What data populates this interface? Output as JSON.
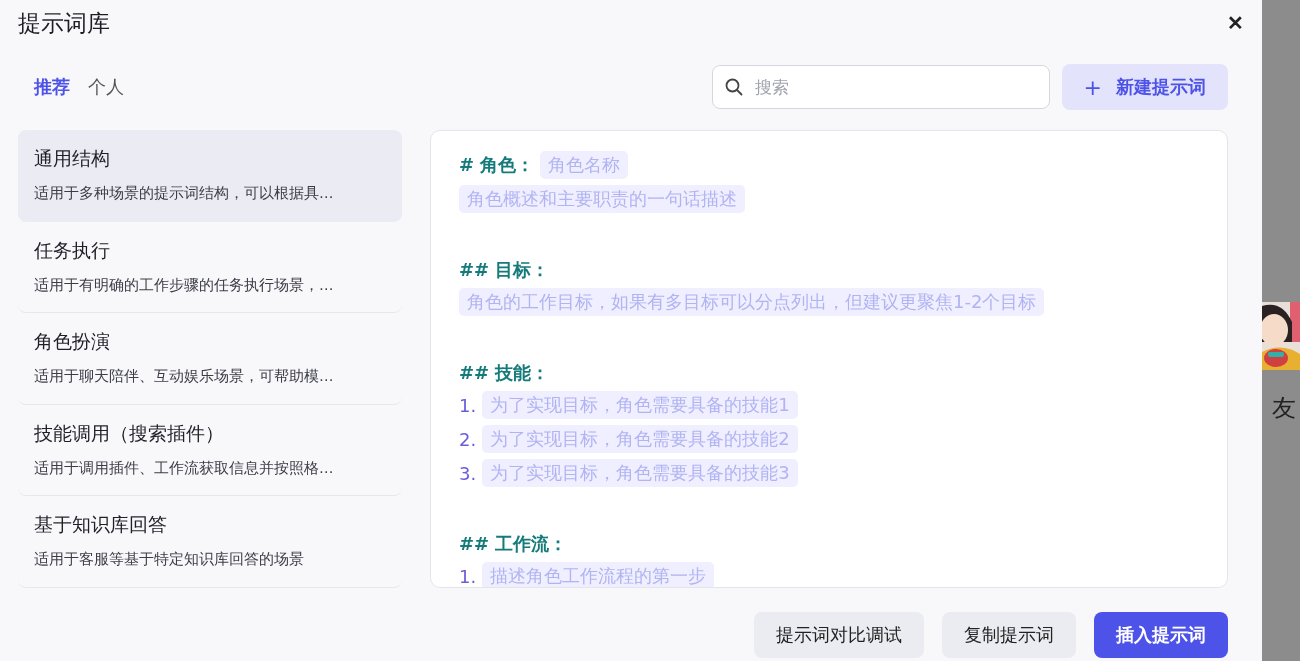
{
  "dialog": {
    "title": "提示词库",
    "close": "✕"
  },
  "tabs": [
    {
      "label": "推荐",
      "selected": true
    },
    {
      "label": "个人",
      "selected": false
    }
  ],
  "search": {
    "placeholder": "搜索"
  },
  "new_button": {
    "icon": "+",
    "label": "新建提示词"
  },
  "templates": [
    {
      "title": "通用结构",
      "description": "适用于多种场景的提示词结构，可以根据具…",
      "selected": true
    },
    {
      "title": "任务执行",
      "description": "适用于有明确的工作步骤的任务执行场景，…",
      "selected": false
    },
    {
      "title": "角色扮演",
      "description": "适用于聊天陪伴、互动娱乐场景，可帮助模…",
      "selected": false
    },
    {
      "title": "技能调用（搜索插件）",
      "description": "适用于调用插件、工作流获取信息并按照格…",
      "selected": false
    },
    {
      "title": "基于知识库回答",
      "description": "适用于客服等基于特定知识库回答的场景",
      "selected": false
    }
  ],
  "preview": {
    "sections": [
      {
        "heading": "# 角色：",
        "heading_chip": "角色名称",
        "lines": [
          {
            "kind": "chip",
            "text": "角色概述和主要职责的一句话描述"
          }
        ]
      },
      {
        "heading": "## 目标：",
        "lines": [
          {
            "kind": "chip",
            "text": "角色的工作目标，如果有多目标可以分点列出，但建议更聚焦1-2个目标"
          }
        ]
      },
      {
        "heading": "## 技能：",
        "lines": [
          {
            "kind": "numbered",
            "number": "1.",
            "text": "为了实现目标，角色需要具备的技能1"
          },
          {
            "kind": "numbered",
            "number": "2.",
            "text": "为了实现目标，角色需要具备的技能2"
          },
          {
            "kind": "numbered",
            "number": "3.",
            "text": "为了实现目标，角色需要具备的技能3"
          }
        ]
      },
      {
        "heading": "## 工作流：",
        "lines": [
          {
            "kind": "numbered",
            "number": "1.",
            "text": "描述角色工作流程的第一步"
          }
        ]
      }
    ]
  },
  "footer_buttons": [
    {
      "label": "提示词对比调试",
      "kind": "secondary"
    },
    {
      "label": "复制提示词",
      "kind": "secondary"
    },
    {
      "label": "插入提示词",
      "kind": "primary"
    }
  ],
  "background": {
    "caption": "友",
    "kind": "picture"
  }
}
